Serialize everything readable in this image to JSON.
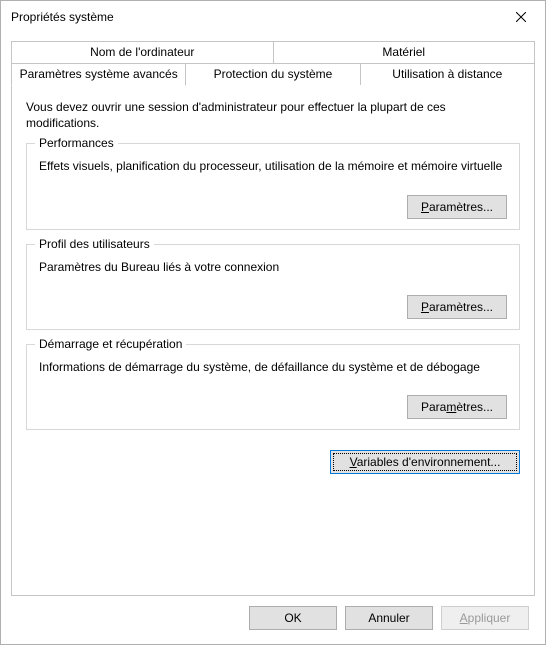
{
  "window": {
    "title": "Propriétés système"
  },
  "tabs": {
    "row1": [
      {
        "label": "Nom de l'ordinateur"
      },
      {
        "label": "Matériel"
      }
    ],
    "row2": [
      {
        "label": "Paramètres système avancés",
        "active": true
      },
      {
        "label": "Protection du système"
      },
      {
        "label": "Utilisation à distance"
      }
    ]
  },
  "panel": {
    "intro": "Vous devez ouvrir une session d'administrateur pour effectuer la plupart de ces modifications.",
    "groups": {
      "perf": {
        "legend": "Performances",
        "desc": "Effets visuels, planification du processeur, utilisation de la mémoire et mémoire virtuelle",
        "button_pre": "P",
        "button_post": "aramètres..."
      },
      "profiles": {
        "legend": "Profil des utilisateurs",
        "desc": "Paramètres du Bureau liés à votre connexion",
        "button_pre": "P",
        "button_post": "aramètres..."
      },
      "startup": {
        "legend": "Démarrage et récupération",
        "desc": "Informations de démarrage du système, de défaillance du système et de débogage",
        "button_pre": "Para",
        "button_u": "m",
        "button_post": "ètres..."
      }
    },
    "env_button_pre": "V",
    "env_button_post": "ariables d'environnement..."
  },
  "footer": {
    "ok": "OK",
    "cancel": "Annuler",
    "apply_pre": "A",
    "apply_post": "ppliquer"
  }
}
